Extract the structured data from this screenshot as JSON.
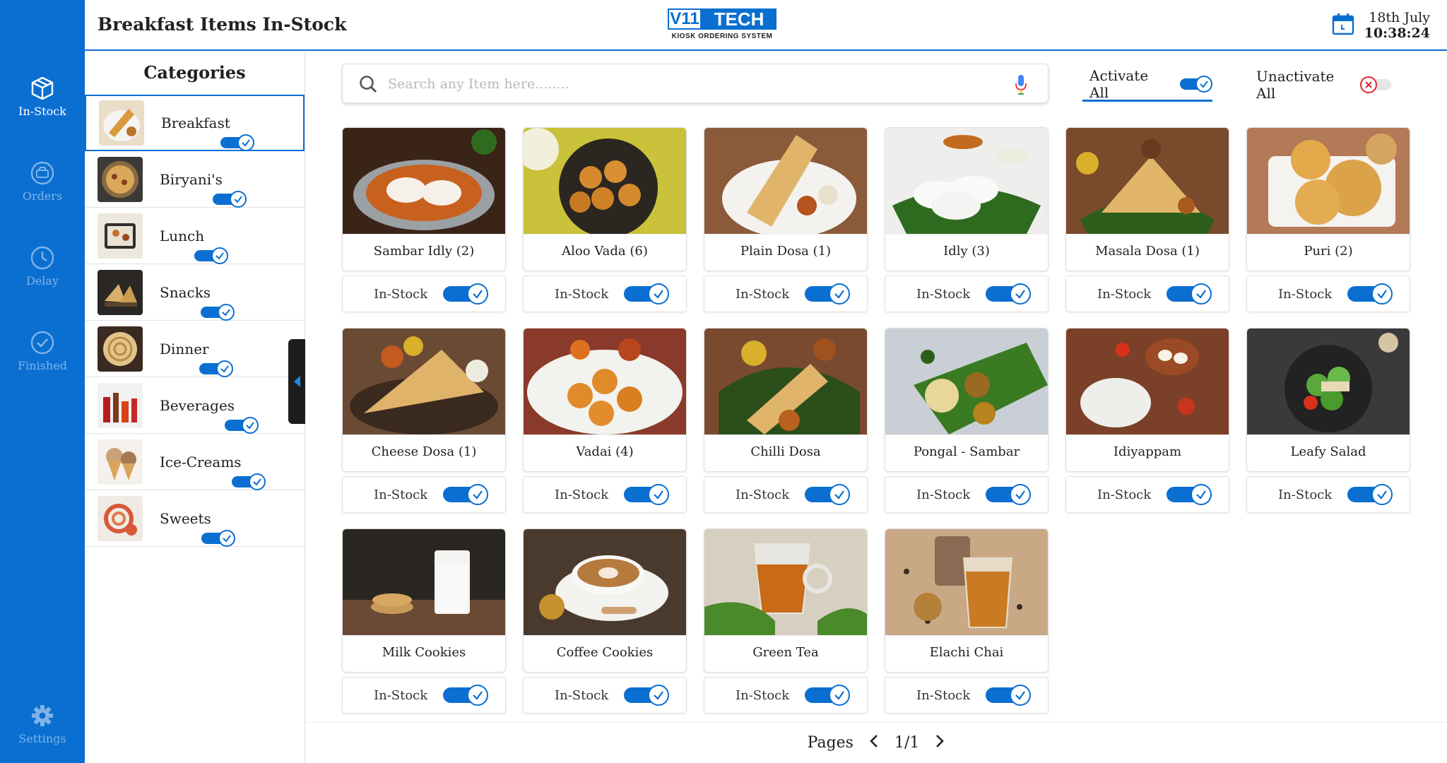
{
  "header": {
    "title": "Breakfast Items In-Stock",
    "logo_mark": "V11",
    "logo_word": "TECH",
    "logo_tagline": "KIOSK ORDERING SYSTEM",
    "date": "18th July",
    "time": "10:38:24"
  },
  "rail": [
    {
      "label": "In-Stock",
      "icon": "box-icon",
      "active": true
    },
    {
      "label": "Orders",
      "icon": "orders-icon",
      "active": false
    },
    {
      "label": "Delay",
      "icon": "clock-icon",
      "active": false
    },
    {
      "label": "Finished",
      "icon": "check-circle-icon",
      "active": false
    },
    {
      "label": "Settings",
      "icon": "gear-icon",
      "active": false
    }
  ],
  "categories": {
    "title": "Categories",
    "items": [
      {
        "label": "Breakfast",
        "active": true,
        "on": true
      },
      {
        "label": "Biryani's",
        "active": false,
        "on": true
      },
      {
        "label": "Lunch",
        "active": false,
        "on": true
      },
      {
        "label": "Snacks",
        "active": false,
        "on": true
      },
      {
        "label": "Dinner",
        "active": false,
        "on": true
      },
      {
        "label": "Beverages",
        "active": false,
        "on": true
      },
      {
        "label": "Ice-Creams",
        "active": false,
        "on": true
      },
      {
        "label": "Sweets",
        "active": false,
        "on": true
      }
    ]
  },
  "search": {
    "placeholder": "Search any Item here........"
  },
  "bulk": {
    "activate_all": "Activate All",
    "unactivate_all": "Unactivate All"
  },
  "stock_label": "In-Stock",
  "items": [
    {
      "name": "Sambar Idly (2)",
      "in_stock": true
    },
    {
      "name": "Aloo Vada (6)",
      "in_stock": true
    },
    {
      "name": "Plain Dosa (1)",
      "in_stock": true
    },
    {
      "name": "Idly (3)",
      "in_stock": true
    },
    {
      "name": "Masala Dosa (1)",
      "in_stock": true
    },
    {
      "name": "Puri (2)",
      "in_stock": true
    },
    {
      "name": "Cheese Dosa (1)",
      "in_stock": true
    },
    {
      "name": "Vadai (4)",
      "in_stock": true
    },
    {
      "name": "Chilli Dosa",
      "in_stock": true
    },
    {
      "name": "Pongal - Sambar",
      "in_stock": true
    },
    {
      "name": "Idiyappam",
      "in_stock": true
    },
    {
      "name": "Leafy Salad",
      "in_stock": true
    },
    {
      "name": "Milk Cookies",
      "in_stock": true
    },
    {
      "name": "Coffee Cookies",
      "in_stock": true
    },
    {
      "name": "Green Tea",
      "in_stock": true
    },
    {
      "name": "Elachi Chai",
      "in_stock": true
    }
  ],
  "pager": {
    "label": "Pages",
    "current": "1/1"
  },
  "colors": {
    "accent": "#0a6fd1",
    "danger": "#e0262e"
  }
}
